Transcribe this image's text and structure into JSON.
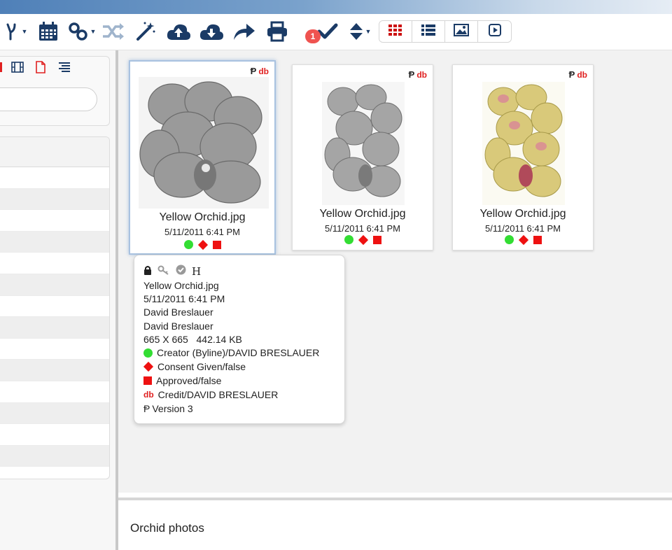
{
  "toolbar": {
    "notification_count": "1",
    "icons": [
      "version-branch-icon",
      "calendar-icon",
      "link-icon",
      "shuffle-icon",
      "magic-wand-icon",
      "cloud-upload-icon",
      "cloud-download-icon",
      "share-icon",
      "print-icon",
      "checkmark-icon",
      "sort-icon"
    ],
    "view_modes": [
      "grid-view",
      "list-view",
      "image-view",
      "video-view"
    ],
    "accent_color": "#1b3b66",
    "active_view_color": "#cc1111"
  },
  "left_panel": {
    "filter_icons": [
      "film-strip-icon",
      "document-icon",
      "text-lines-icon"
    ],
    "search": {
      "value": "",
      "placeholder": ""
    }
  },
  "cards": [
    {
      "filename": "Yellow Orchid.jpg",
      "date": "5/11/2011 6:41 PM",
      "version_mark": "Ᵽ",
      "db_mark": "db",
      "selected": true,
      "tone": "grayscale"
    },
    {
      "filename": "Yellow Orchid.jpg",
      "date": "5/11/2011 6:41 PM",
      "version_mark": "Ᵽ",
      "db_mark": "db",
      "selected": false,
      "tone": "grayscale"
    },
    {
      "filename": "Yellow Orchid.jpg",
      "date": "5/11/2011 6:41 PM",
      "version_mark": "Ᵽ",
      "db_mark": "db",
      "selected": false,
      "tone": "color"
    }
  ],
  "tooltip": {
    "header_letter": "H",
    "filename": "Yellow Orchid.jpg",
    "date": "5/11/2011 6:41 PM",
    "author1": "David Breslauer",
    "author2": "David Breslauer",
    "dimensions": "665 X 665   442.14 KB",
    "creator": "Creator (Byline)/DAVID BRESLAUER",
    "consent": "Consent Given/false",
    "approved": "Approved/false",
    "db_label": "db",
    "credit": "Credit/DAVID BRESLAUER",
    "version_mark": "Ᵽ",
    "version": "Version 3"
  },
  "collection_name": "Orchid photos"
}
